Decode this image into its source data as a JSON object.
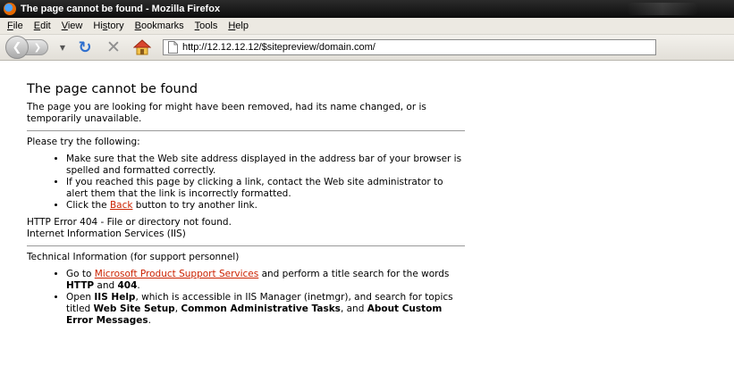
{
  "window": {
    "title": "The page cannot be found - Mozilla Firefox"
  },
  "menu": [
    {
      "accel": "F",
      "rest": "ile"
    },
    {
      "accel": "E",
      "rest": "dit"
    },
    {
      "accel": "V",
      "rest": "iew"
    },
    {
      "pre": "Hi",
      "accel": "s",
      "rest": "tory"
    },
    {
      "accel": "B",
      "rest": "ookmarks"
    },
    {
      "accel": "T",
      "rest": "ools"
    },
    {
      "accel": "H",
      "rest": "elp"
    }
  ],
  "toolbar": {
    "url": "http://12.12.12.12/$sitepreview/domain.com/"
  },
  "page": {
    "title": "The page cannot be found",
    "intro": "The page you are looking for might have been removed, had its name changed, or is temporarily unavailable.",
    "try_heading": "Please try the following:",
    "try_items": {
      "item1": "Make sure that the Web site address displayed in the address bar of your browser is spelled and formatted correctly.",
      "item2": "If you reached this page by clicking a link, contact the Web site administrator to alert them that the link is incorrectly formatted.",
      "item3_pre": "Click the ",
      "item3_link": "Back",
      "item3_post": " button to try another link."
    },
    "http_error": "HTTP Error 404 - File or directory not found.",
    "iis": "Internet Information Services (IIS)",
    "tech_heading": "Technical Information (for support personnel)",
    "tech_items": {
      "item1_pre": "Go to ",
      "item1_link": "Microsoft Product Support Services",
      "item1_mid": " and perform a title search for the words ",
      "item1_b1": "HTTP",
      "item1_and": " and ",
      "item1_b2": "404",
      "item1_end": ".",
      "item2_pre": "Open ",
      "item2_b1": "IIS Help",
      "item2_mid": ", which is accessible in IIS Manager (inetmgr), and search for topics titled ",
      "item2_b2": "Web Site Setup",
      "item2_c1": ", ",
      "item2_b3": "Common Administrative Tasks",
      "item2_c2": ", and ",
      "item2_b4": "About Custom Error Messages",
      "item2_end": "."
    }
  }
}
